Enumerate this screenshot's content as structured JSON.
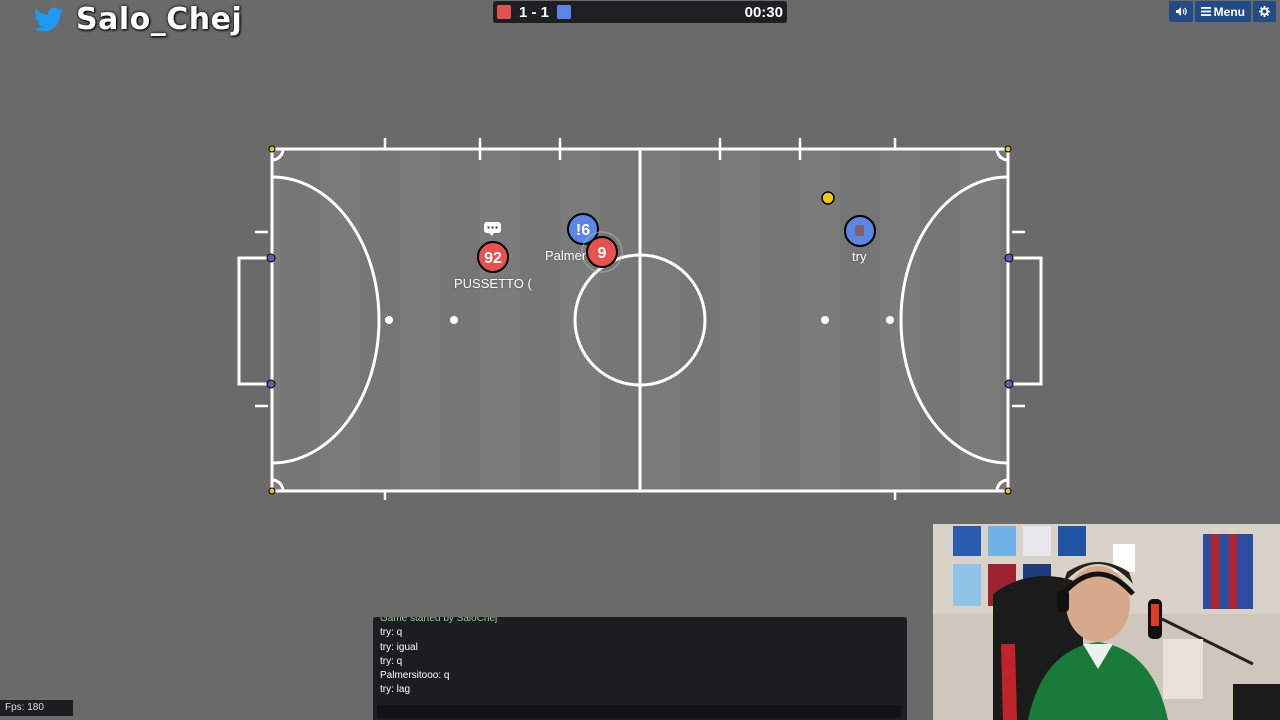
{
  "overlay": {
    "channel_name": "Salo_Chej",
    "icon": "twitter-bird-icon"
  },
  "scoreboard": {
    "score": "1 - 1",
    "time": "00:30",
    "red_color": "#e5524f",
    "blue_color": "#5b86e5"
  },
  "topbar": {
    "sound_icon": "speaker-icon",
    "menu_label": "Menu",
    "settings_icon": "gear-icon"
  },
  "players": [
    {
      "team": "red",
      "number": "92",
      "nick": "PUSSETTO (",
      "typing": true
    },
    {
      "team": "blue",
      "number": "!6",
      "nick": "Palmer"
    },
    {
      "team": "red",
      "number": "9",
      "nick": ""
    },
    {
      "team": "blue",
      "number": "",
      "nick": "try"
    }
  ],
  "chat": {
    "messages": [
      "Game started by SaloChej",
      "try: q",
      "try: igual",
      "try: q",
      "Palmersitooo: q",
      "try: lag"
    ]
  },
  "fps": "Fps: 180",
  "colors": {
    "field": "#7a7a7a",
    "lines": "#ffffff",
    "ball": "#f5c518",
    "background": "#6a6a6a"
  }
}
